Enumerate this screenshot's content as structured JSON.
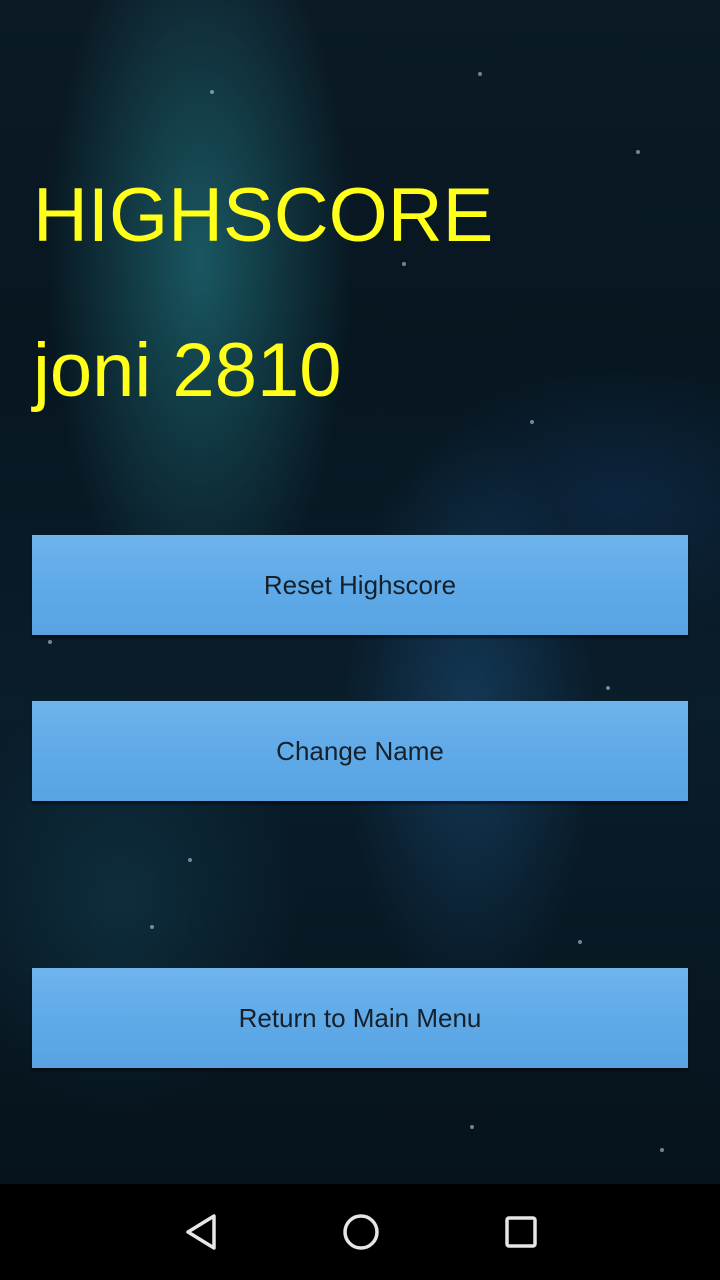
{
  "highscore": {
    "title": "HIGHSCORE",
    "entry": "joni 2810"
  },
  "buttons": {
    "reset": "Reset Highscore",
    "change_name": "Change Name",
    "return_menu": "Return to Main Menu"
  },
  "navbar": {
    "back_icon": "back-triangle-icon",
    "home_icon": "home-circle-icon",
    "recents_icon": "recents-square-icon"
  },
  "colors": {
    "title_text": "#ffff1a",
    "button_bg": "#5ea9e8",
    "button_text": "#15202a",
    "navbar_bg": "#000000"
  }
}
